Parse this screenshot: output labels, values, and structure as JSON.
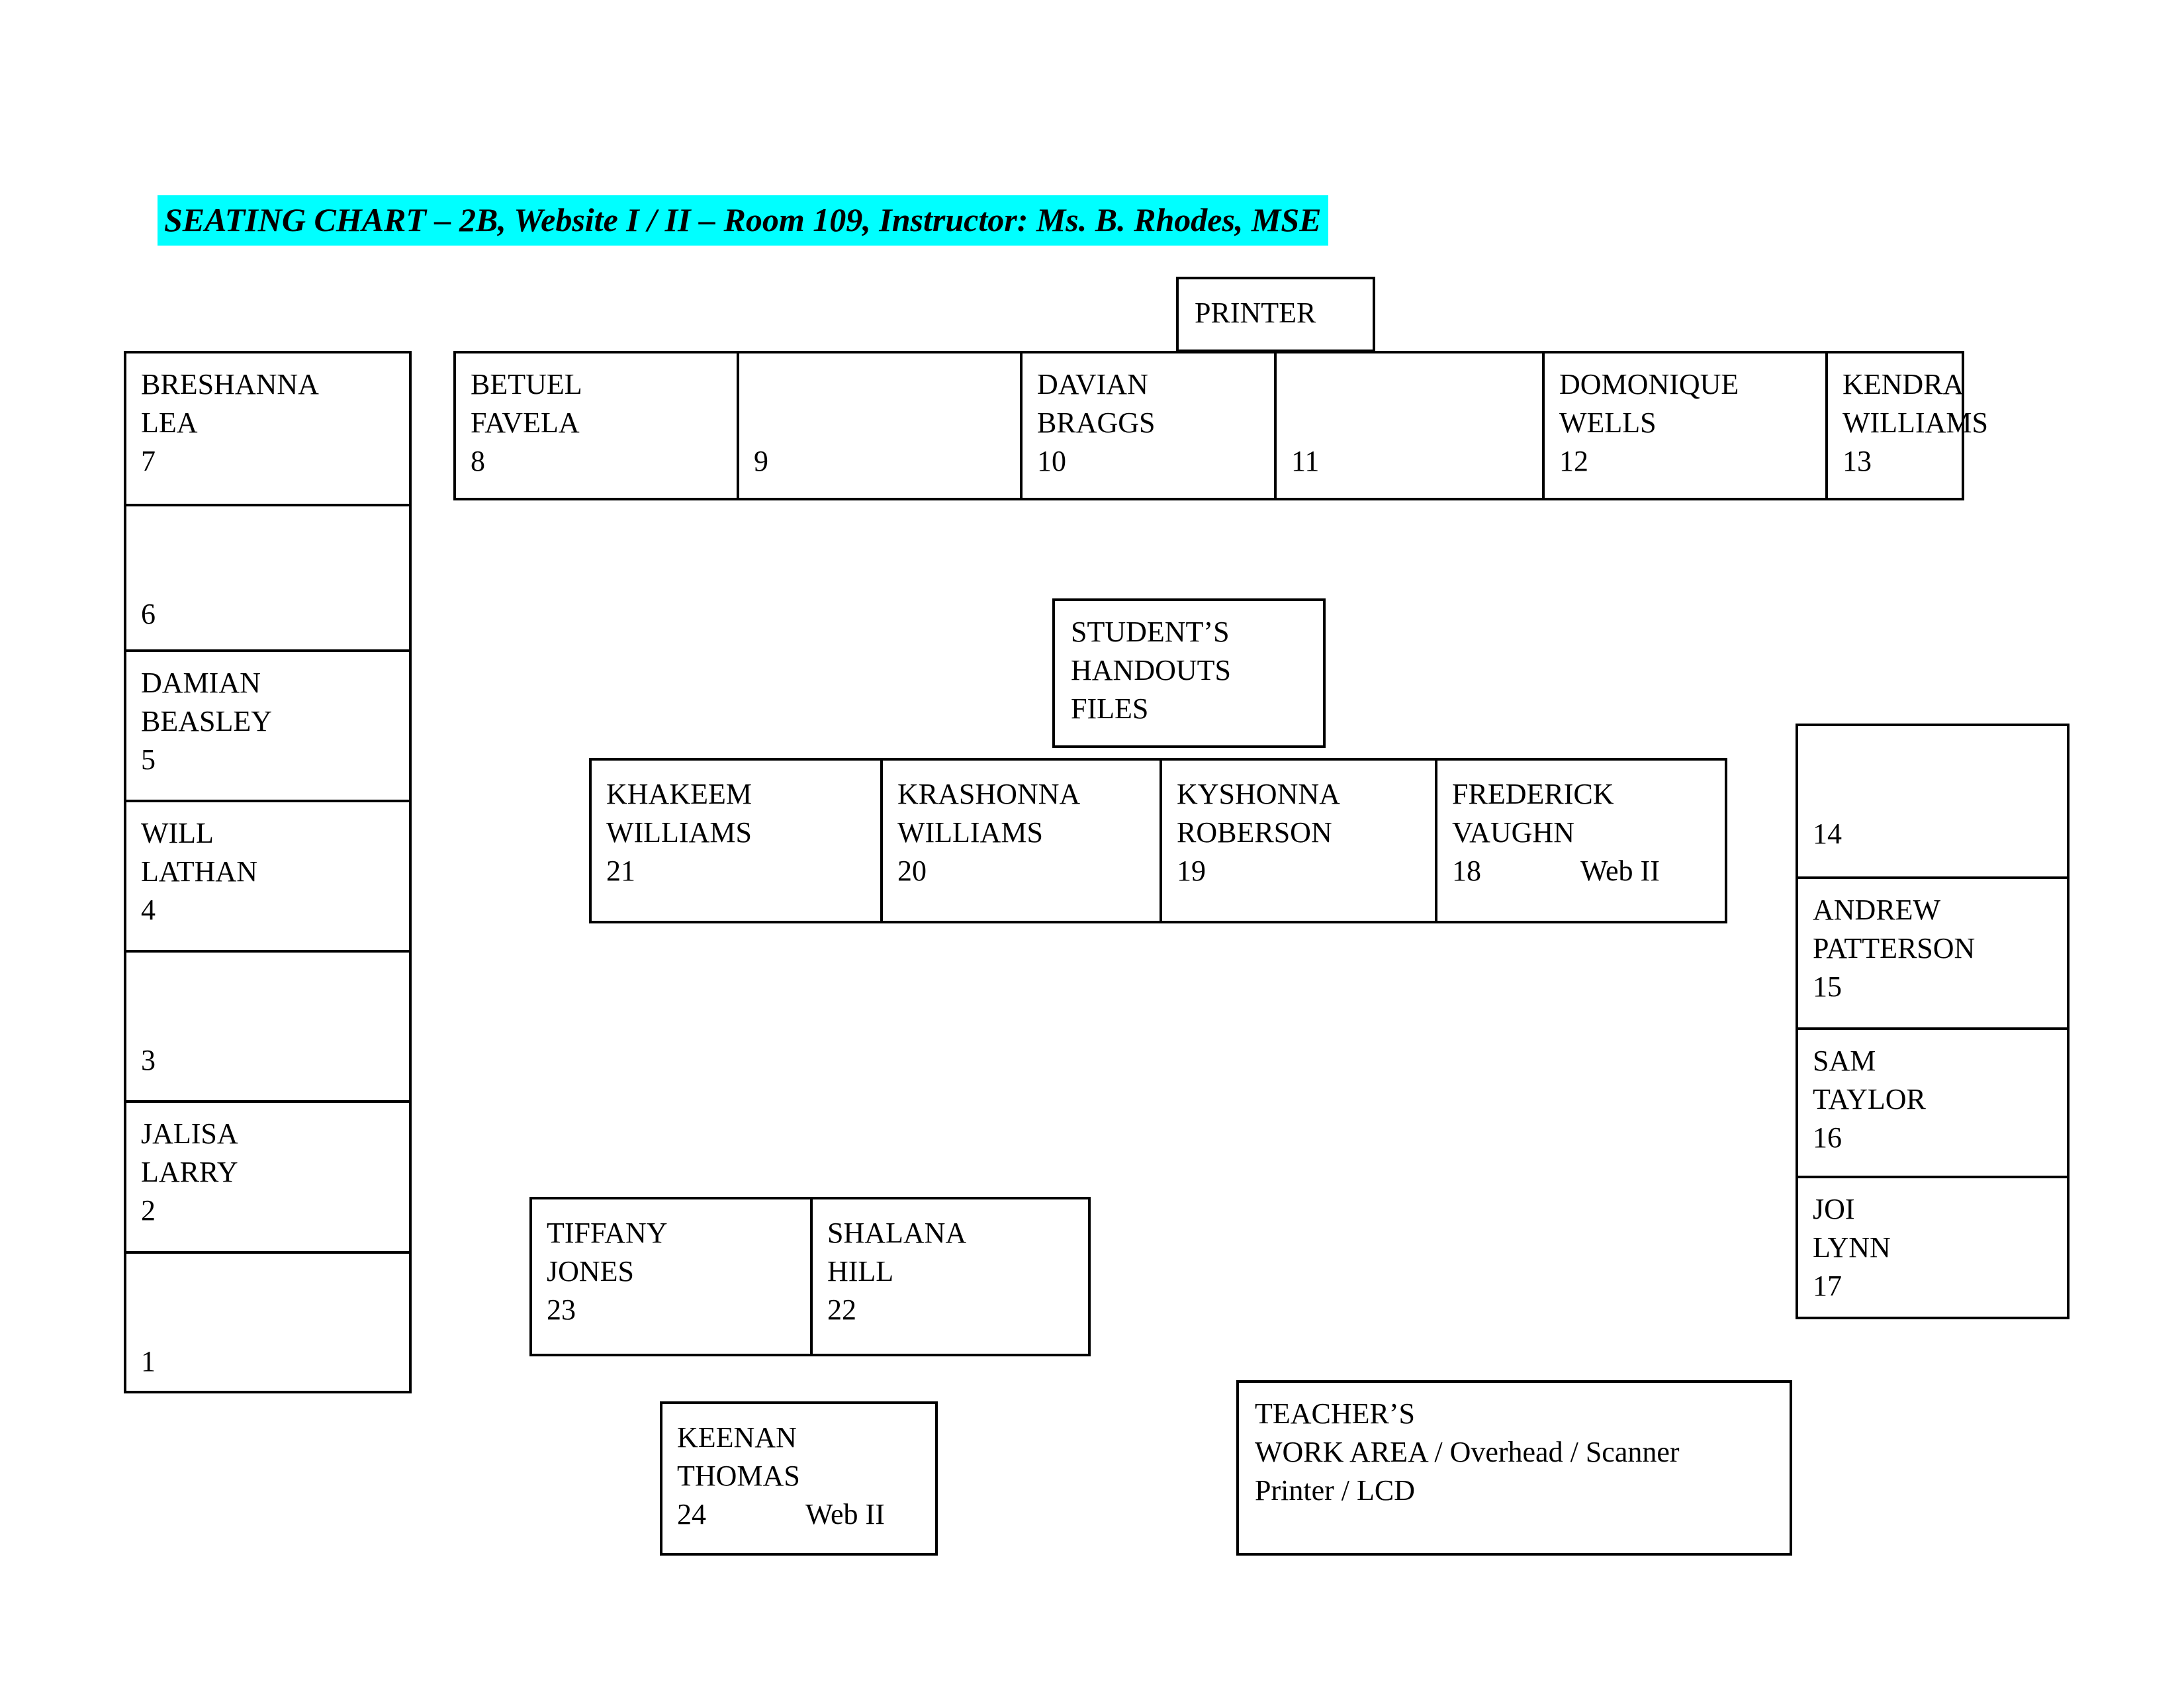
{
  "document": {
    "title": "SEATING CHART – 2B, Website I / II – Room 109, Instructor:  Ms. B. Rhodes, MSE",
    "highlight_color": "#00FFFF",
    "text_color": "#000000"
  },
  "fixtures": {
    "printer": {
      "label": "PRINTER"
    },
    "handouts": {
      "line1": "STUDENT’S",
      "line2": "HANDOUTS",
      "line3": "FILES"
    },
    "teacher_area": {
      "line1": "TEACHER’S",
      "line2": "WORK AREA / Overhead / Scanner",
      "line3": "Printer / LCD"
    }
  },
  "left_column": {
    "seats": [
      {
        "name_line1": "BRESHANNA",
        "name_line2": "LEA",
        "seat": "7",
        "tag": ""
      },
      {
        "name_line1": "",
        "name_line2": "",
        "seat": "6",
        "tag": ""
      },
      {
        "name_line1": "DAMIAN",
        "name_line2": "BEASLEY",
        "seat": "5",
        "tag": ""
      },
      {
        "name_line1": "WILL",
        "name_line2": "LATHAN",
        "seat": "4",
        "tag": ""
      },
      {
        "name_line1": "",
        "name_line2": "",
        "seat": "3",
        "tag": ""
      },
      {
        "name_line1": "JALISA",
        "name_line2": "LARRY",
        "seat": "2",
        "tag": ""
      },
      {
        "name_line1": "",
        "name_line2": "",
        "seat": "1",
        "tag": ""
      }
    ]
  },
  "top_row": {
    "seats": [
      {
        "name_line1": "BETUEL",
        "name_line2": "FAVELA",
        "seat": "8",
        "tag": ""
      },
      {
        "name_line1": "",
        "name_line2": "",
        "seat": "9",
        "tag": ""
      },
      {
        "name_line1": "DAVIAN",
        "name_line2": "BRAGGS",
        "seat": "10",
        "tag": ""
      },
      {
        "name_line1": "",
        "name_line2": "",
        "seat": "11",
        "tag": ""
      },
      {
        "name_line1": "DOMONIQUE",
        "name_line2": "WELLS",
        "seat": "12",
        "tag": ""
      },
      {
        "name_line1": "KENDRA",
        "name_line2": "WILLIAMS",
        "seat": "13",
        "tag": ""
      }
    ]
  },
  "middle_row": {
    "seats": [
      {
        "name_line1": "KHAKEEM",
        "name_line2": "WILLIAMS",
        "seat": "21",
        "tag": ""
      },
      {
        "name_line1": "KRASHONNA",
        "name_line2": "WILLIAMS",
        "seat": "20",
        "tag": ""
      },
      {
        "name_line1": "KYSHONNA",
        "name_line2": "ROBERSON",
        "seat": "19",
        "tag": ""
      },
      {
        "name_line1": "FREDERICK",
        "name_line2": "VAUGHN",
        "seat": "18",
        "tag": "Web II"
      }
    ]
  },
  "right_column": {
    "seats": [
      {
        "name_line1": "",
        "name_line2": "",
        "seat": "14",
        "tag": ""
      },
      {
        "name_line1": "ANDREW",
        "name_line2": "PATTERSON",
        "seat": "15",
        "tag": ""
      },
      {
        "name_line1": "SAM",
        "name_line2": "TAYLOR",
        "seat": "16",
        "tag": ""
      },
      {
        "name_line1": "JOI",
        "name_line2": "LYNN",
        "seat": "17",
        "tag": ""
      }
    ]
  },
  "bottom_pair": {
    "seats": [
      {
        "name_line1": "TIFFANY",
        "name_line2": "JONES",
        "seat": "23",
        "tag": ""
      },
      {
        "name_line1": "SHALANA",
        "name_line2": "HILL",
        "seat": "22",
        "tag": ""
      }
    ]
  },
  "bottom_single": {
    "seats": [
      {
        "name_line1": "KEENAN",
        "name_line2": "THOMAS",
        "seat": "24",
        "tag": "Web II"
      }
    ]
  }
}
